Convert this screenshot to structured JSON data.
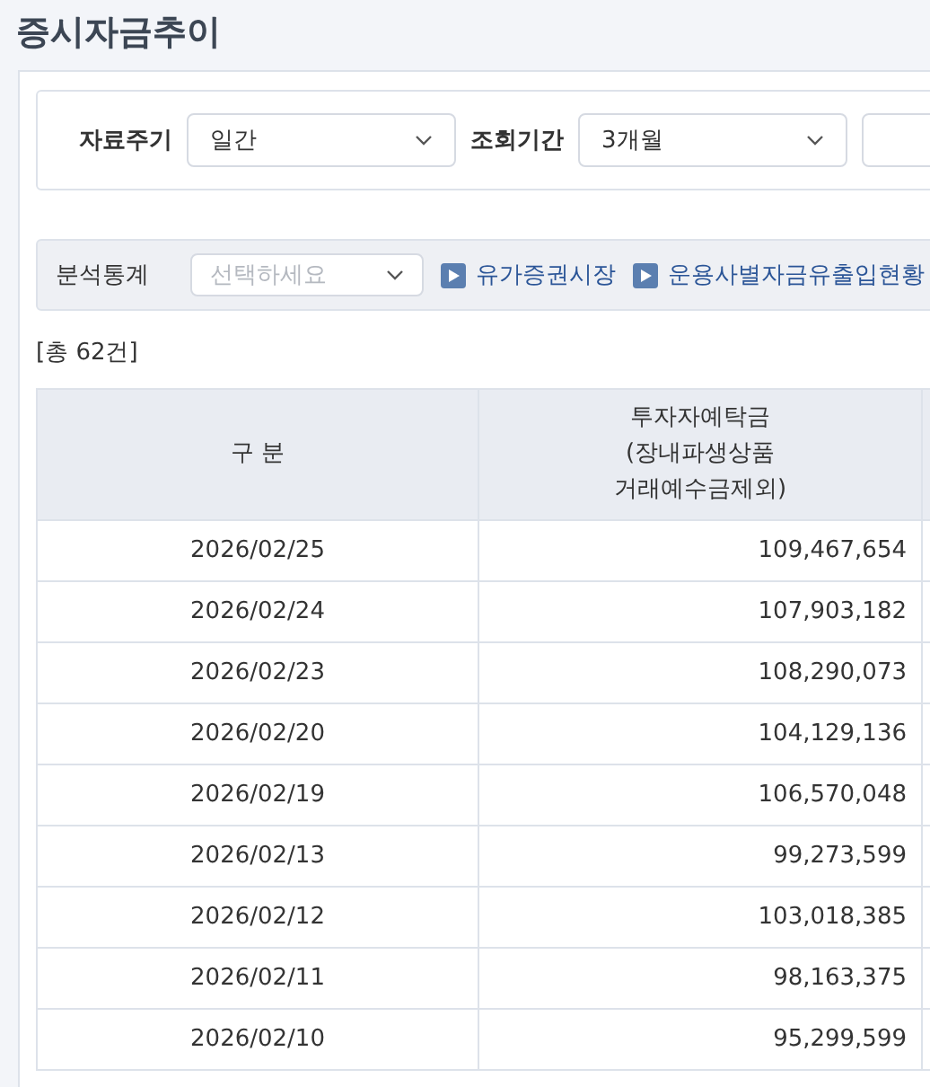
{
  "page_title": "증시자금추이",
  "filters": [
    {
      "label": "자료주기",
      "value": "일간"
    },
    {
      "label": "조회기간",
      "value": "3개월"
    }
  ],
  "analysis": {
    "label": "분석통계",
    "placeholder": "선택하세요",
    "links": [
      "유가증권시장",
      "운용사별자금유출입현황"
    ]
  },
  "total": "[총 62건]",
  "table": {
    "columns": [
      "구 분",
      "투자자예탁금\n(장내파생상품\n거래예수금제외)"
    ],
    "rows": [
      [
        "2026/02/25",
        "109,467,654"
      ],
      [
        "2026/02/24",
        "107,903,182"
      ],
      [
        "2026/02/23",
        "108,290,073"
      ],
      [
        "2026/02/20",
        "104,129,136"
      ],
      [
        "2026/02/19",
        "106,570,048"
      ],
      [
        "2026/02/13",
        "99,273,599"
      ],
      [
        "2026/02/12",
        "103,018,385"
      ],
      [
        "2026/02/11",
        "98,163,375"
      ],
      [
        "2026/02/10",
        "95,299,599"
      ]
    ]
  }
}
